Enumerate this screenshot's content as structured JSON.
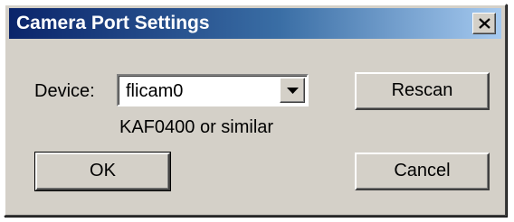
{
  "window": {
    "title": "Camera Port Settings",
    "close_glyph": "✕",
    "colors": {
      "titlebar_start": "#0a246a",
      "titlebar_end": "#a6caf0",
      "face": "#d4d0c8"
    }
  },
  "device": {
    "label": "Device:",
    "selected": "flicam0",
    "description": "KAF0400 or similar"
  },
  "buttons": {
    "rescan": "Rescan",
    "ok": "OK",
    "cancel": "Cancel"
  },
  "icons": {
    "close": "close-icon",
    "dropdown": "chevron-down-icon"
  }
}
